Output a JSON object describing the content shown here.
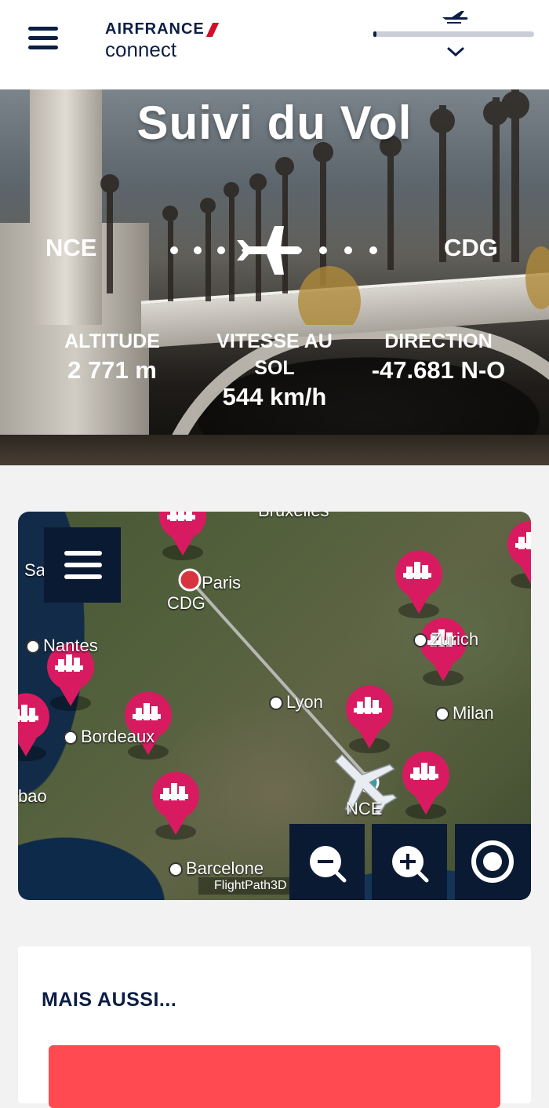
{
  "header": {
    "brand_top": "AIRFRANCE",
    "brand_bottom": "connect",
    "menu_icon": "hamburger-icon",
    "progress_icon": "plane-takeoff-icon",
    "expand_icon": "chevron-down-icon",
    "progress_fraction": 0.02
  },
  "hero": {
    "title": "Suivi du Vol",
    "origin": "NCE",
    "destination": "CDG",
    "stats": {
      "altitude_label": "ALTITUDE",
      "altitude_value": "2 771 m",
      "speed_label": "VITESSE AU SOL",
      "speed_value": "544 km/h",
      "direction_label": "DIRECTION",
      "direction_value": "-47.681 N-O"
    }
  },
  "map": {
    "cities": {
      "brussels": "Bruxelles",
      "paris": "Paris",
      "cdg": "CDG",
      "nantes": "Nantes",
      "lyon": "Lyon",
      "zurich": "Zurich",
      "milan": "Milan",
      "bordeaux": "Bordeaux",
      "bilbao": "bao",
      "nce": "NCE",
      "barcelona": "Barcelone",
      "saint": "Sa"
    },
    "attribution": "FlightPath3D",
    "controls": [
      "map-menu-button",
      "zoom-out-button",
      "zoom-in-button",
      "recenter-button"
    ],
    "accent_pin": "#d81b60",
    "route_color": "#c8c8c8"
  },
  "more": {
    "heading": "MAIS AUSSI..."
  }
}
